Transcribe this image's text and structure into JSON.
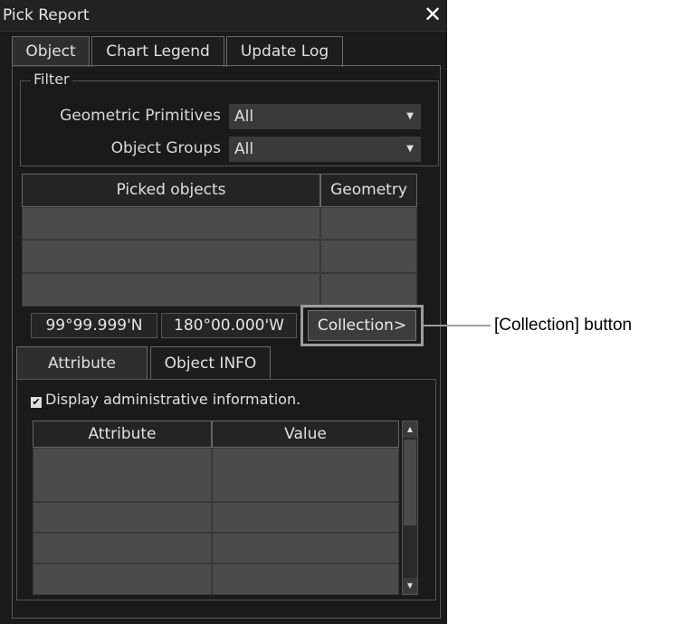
{
  "window": {
    "title": "Pick Report",
    "close_glyph": "✕"
  },
  "tabs": [
    "Object",
    "Chart Legend",
    "Update Log"
  ],
  "filter": {
    "label": "Filter",
    "geometric_primitives": {
      "label": "Geometric Primitives",
      "value": "All"
    },
    "object_groups": {
      "label": "Object Groups",
      "value": "All"
    }
  },
  "picked_table": {
    "headers": [
      "Picked objects",
      "Geometry"
    ],
    "rows": 3
  },
  "position": {
    "lat": "99°99.999'N",
    "lon": "180°00.000'W"
  },
  "collection_button": "Collection>",
  "subtabs": [
    "Attribute",
    "Object INFO"
  ],
  "display_admin": {
    "label": "Display administrative information.",
    "checked": true,
    "check_glyph": "✔"
  },
  "attribute_table": {
    "headers": [
      "Attribute",
      "Value"
    ],
    "rows": 5
  },
  "annotation": {
    "text": "[Collection] button"
  },
  "icons": {
    "dropdown": "chevron-down-icon",
    "close": "close-icon",
    "scroll_up": "scroll-up-icon",
    "scroll_down": "scroll-down-icon"
  }
}
